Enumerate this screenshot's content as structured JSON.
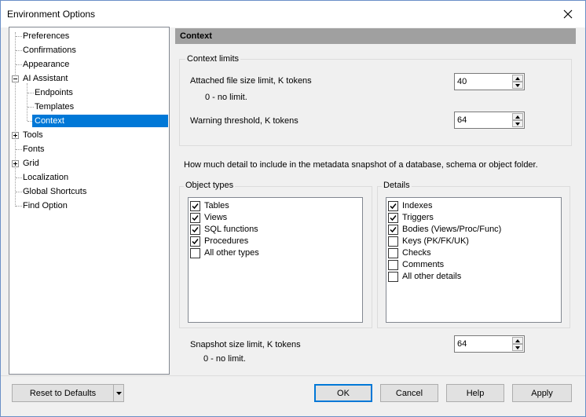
{
  "window": {
    "title": "Environment Options"
  },
  "tree": {
    "items": [
      {
        "label": "Preferences"
      },
      {
        "label": "Confirmations"
      },
      {
        "label": "Appearance"
      },
      {
        "label": "AI Assistant"
      },
      {
        "label": "Endpoints"
      },
      {
        "label": "Templates"
      },
      {
        "label": "Context"
      },
      {
        "label": "Tools"
      },
      {
        "label": "Fonts"
      },
      {
        "label": "Grid"
      },
      {
        "label": "Localization"
      },
      {
        "label": "Global Shortcuts"
      },
      {
        "label": "Find Option"
      }
    ],
    "selected": "Context"
  },
  "panel": {
    "title": "Context",
    "limits_group": "Context limits",
    "attached_label": "Attached file size limit, K tokens",
    "attached_value": "40",
    "attached_hint": "0 - no limit.",
    "warning_label": "Warning threshold, K tokens",
    "warning_value": "64",
    "description": "How much detail to include in the metadata snapshot of a database, schema or object folder.",
    "object_types_group": "Object types",
    "object_types": [
      {
        "label": "Tables",
        "checked": true
      },
      {
        "label": "Views",
        "checked": true
      },
      {
        "label": "SQL functions",
        "checked": true
      },
      {
        "label": "Procedures",
        "checked": true
      },
      {
        "label": "All other types",
        "checked": false
      }
    ],
    "details_group": "Details",
    "details": [
      {
        "label": "Indexes",
        "checked": true
      },
      {
        "label": "Triggers",
        "checked": true
      },
      {
        "label": "Bodies (Views/Proc/Func)",
        "checked": true
      },
      {
        "label": "Keys (PK/FK/UK)",
        "checked": false
      },
      {
        "label": "Checks",
        "checked": false
      },
      {
        "label": "Comments",
        "checked": false
      },
      {
        "label": "All other details",
        "checked": false
      }
    ],
    "snapshot_label": "Snapshot size limit, K tokens",
    "snapshot_value": "64",
    "snapshot_hint": "0 - no limit."
  },
  "buttons": {
    "reset": "Reset to Defaults",
    "ok": "OK",
    "cancel": "Cancel",
    "help": "Help",
    "apply": "Apply"
  }
}
